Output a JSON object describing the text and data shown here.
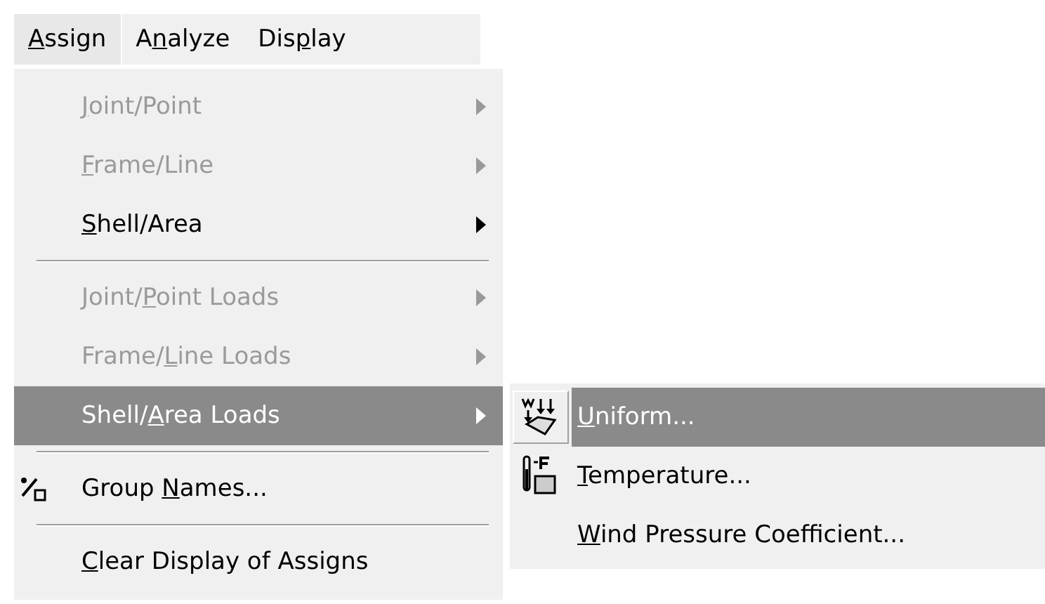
{
  "menubar": [
    {
      "key": "A",
      "after": "ssign",
      "selected": true
    },
    {
      "before": "A",
      "key": "n",
      "after": "alyze",
      "selected": false
    },
    {
      "before": "Dis",
      "key": "p",
      "after": "lay",
      "selected": false
    }
  ],
  "menu": [
    {
      "kind": "item",
      "key": "J",
      "after": "oint/Point",
      "disabled": true,
      "submenu": true,
      "selected": false
    },
    {
      "kind": "item",
      "key": "F",
      "after": "rame/Line",
      "disabled": true,
      "submenu": true,
      "selected": false
    },
    {
      "kind": "item",
      "key": "S",
      "after": "hell/Area",
      "disabled": false,
      "submenu": true,
      "selected": false
    },
    {
      "kind": "separator"
    },
    {
      "kind": "item",
      "before": "Joint/",
      "key": "P",
      "after": "oint Loads",
      "disabled": true,
      "submenu": true,
      "selected": false
    },
    {
      "kind": "item",
      "before": "Frame/",
      "key": "L",
      "after": "ine Loads",
      "disabled": true,
      "submenu": true,
      "selected": false
    },
    {
      "kind": "item",
      "before": "Shell/",
      "key": "A",
      "after": "rea Loads",
      "disabled": false,
      "submenu": true,
      "selected": true
    },
    {
      "kind": "separator"
    },
    {
      "kind": "icon-item",
      "before": "Group ",
      "key": "N",
      "after": "ames...",
      "disabled": false,
      "submenu": false,
      "selected": false
    },
    {
      "kind": "separator"
    },
    {
      "kind": "item",
      "key": "C",
      "after": "lear Display of Assigns",
      "disabled": false,
      "submenu": false,
      "selected": false
    }
  ],
  "submenu": [
    {
      "key": "U",
      "after": "niform...",
      "selected": true
    },
    {
      "key": "T",
      "after": "emperature...",
      "selected": false
    },
    {
      "key": "W",
      "after": "ind Pressure Coefficient...",
      "selected": false
    }
  ]
}
